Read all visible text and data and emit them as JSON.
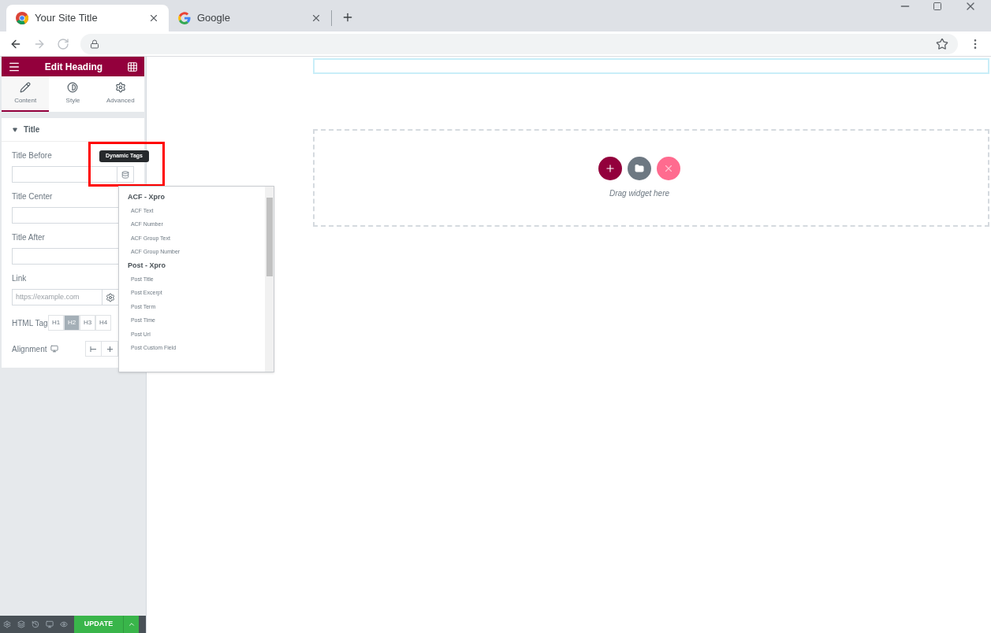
{
  "browser": {
    "tabs": [
      {
        "title": "Your Site Title",
        "selected": true,
        "kind": "chrome"
      },
      {
        "title": "Google",
        "selected": false,
        "kind": "google"
      }
    ]
  },
  "panel": {
    "title": "Edit Heading",
    "tabs": [
      {
        "label": "Content",
        "selected": true,
        "kind": "pencil"
      },
      {
        "label": "Style",
        "selected": false,
        "kind": "contrast"
      },
      {
        "label": "Advanced",
        "selected": false,
        "kind": "gear"
      }
    ],
    "section": {
      "title": "Title",
      "expanded": true
    },
    "fields": [
      {
        "label": "Title Before",
        "kind": "dynamic"
      },
      {
        "label": "Title Center",
        "kind": "text"
      },
      {
        "label": "Title After",
        "kind": "text"
      },
      {
        "label": "Link",
        "kind": "link",
        "placeholder": "https://example.com"
      }
    ],
    "html_tag": {
      "label": "HTML Tag",
      "options": [
        {
          "label": "H1",
          "selected": false
        },
        {
          "label": "H2",
          "selected": true
        },
        {
          "label": "H3",
          "selected": false
        },
        {
          "label": "H4",
          "selected": false
        }
      ]
    },
    "alignment": {
      "label": "Alignment"
    },
    "update_button": "UPDATE"
  },
  "tooltip": "Dynamic Tags",
  "dynamic_tags": [
    {
      "group": "ACF - Xpro",
      "items": [
        "ACF Text",
        "ACF Number",
        "ACF Group Text",
        "ACF Group Number"
      ]
    },
    {
      "group": "Post - Xpro",
      "items": [
        "Post Title",
        "Post Excerpt",
        "Post Term",
        "Post Time",
        "Post Url",
        "Post Custom Field"
      ]
    }
  ],
  "canvas": {
    "drop_hint": "Drag widget here"
  }
}
